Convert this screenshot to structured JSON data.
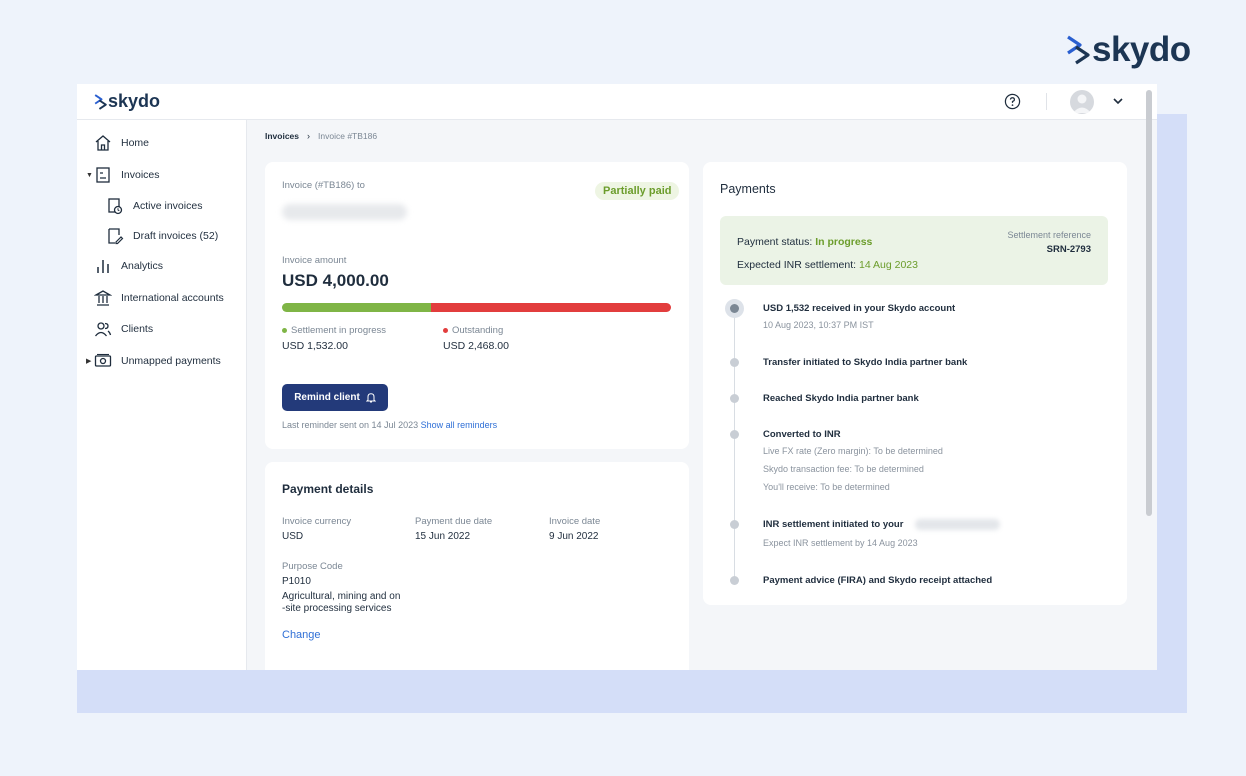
{
  "brand": {
    "name": "skydo"
  },
  "sidebar": {
    "items": [
      {
        "label": "Home",
        "icon": "home-icon"
      },
      {
        "label": "Invoices",
        "icon": "invoice-icon"
      },
      {
        "label": "Active invoices",
        "icon": "active-invoice-icon"
      },
      {
        "label": "Draft invoices (52)",
        "icon": "draft-invoice-icon"
      },
      {
        "label": "Analytics",
        "icon": "analytics-icon"
      },
      {
        "label": "International accounts",
        "icon": "bank-icon"
      },
      {
        "label": "Clients",
        "icon": "clients-icon"
      },
      {
        "label": "Unmapped payments",
        "icon": "payments-icon"
      }
    ]
  },
  "breadcrumb": {
    "parent": "Invoices",
    "current": "Invoice #TB186"
  },
  "invoice": {
    "heading": "Invoice (#TB186) to",
    "status": "Partially paid",
    "amount_label": "Invoice amount",
    "amount": "USD 4,000.00",
    "settled_fraction": 0.383,
    "settlement_label": "Settlement in progress",
    "settlement_value": "USD 1,532.00",
    "outstanding_label": "Outstanding",
    "outstanding_value": "USD 2,468.00",
    "remind_button": "Remind client",
    "last_reminder": "Last reminder sent on 14 Jul 2023",
    "show_reminders": "Show all reminders"
  },
  "payment_details": {
    "title": "Payment details",
    "currency_label": "Invoice currency",
    "currency": "USD",
    "due_label": "Payment due date",
    "due": "15 Jun 2022",
    "date_label": "Invoice date",
    "date": "9 Jun 2022",
    "purpose_label": "Purpose Code",
    "purpose_code": "P1010",
    "purpose_desc": "Agricultural, mining and on -site processing services",
    "change_link": "Change"
  },
  "payments": {
    "title": "Payments",
    "status_label": "Payment status:",
    "status_value": "In progress",
    "expected_label": "Expected INR settlement:",
    "expected_value": "14 Aug 2023",
    "ref_label": "Settlement reference",
    "ref_value": "SRN-2793",
    "timeline": [
      {
        "title": "USD 1,532 received in your Skydo account",
        "sub": [
          "10 Aug 2023, 10:37 PM IST"
        ]
      },
      {
        "title": "Transfer initiated to Skydo India partner bank",
        "sub": []
      },
      {
        "title": "Reached Skydo India partner bank",
        "sub": []
      },
      {
        "title": "Converted to INR",
        "sub": [
          "Live FX rate (Zero margin): To be determined",
          "Skydo transaction fee: To be determined",
          "You'll receive: To be determined"
        ]
      },
      {
        "title": "INR settlement initiated to your",
        "sub": [
          "Expect INR settlement by 14 Aug 2023"
        ]
      },
      {
        "title": "Payment advice (FIRA) and Skydo receipt attached",
        "sub": []
      }
    ]
  },
  "colors": {
    "navy": "#233a7a",
    "green": "#7fb546",
    "red": "#e23d3d",
    "status_green": "#6c9d2c"
  }
}
